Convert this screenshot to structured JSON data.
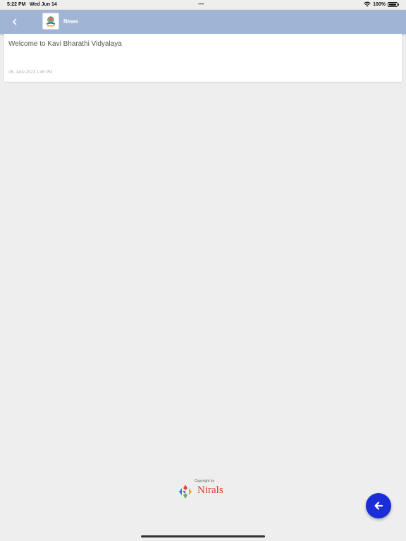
{
  "status_bar": {
    "time": "5:22 PM",
    "date": "Wed Jun 14",
    "dots": "•••",
    "battery": "100%"
  },
  "header": {
    "title": "News",
    "background": "#a0b4d6",
    "back_icon": "chevron-left-icon"
  },
  "news": [
    {
      "title": "Welcome to Kavi Bharathi Vidyalaya",
      "date": "06, June 2023 1:46 PM"
    }
  ],
  "footer": {
    "copyright": "Copyright by",
    "brand": "Nirals"
  },
  "fab": {
    "icon": "arrow-left-icon",
    "color": "#1a2dd6"
  }
}
